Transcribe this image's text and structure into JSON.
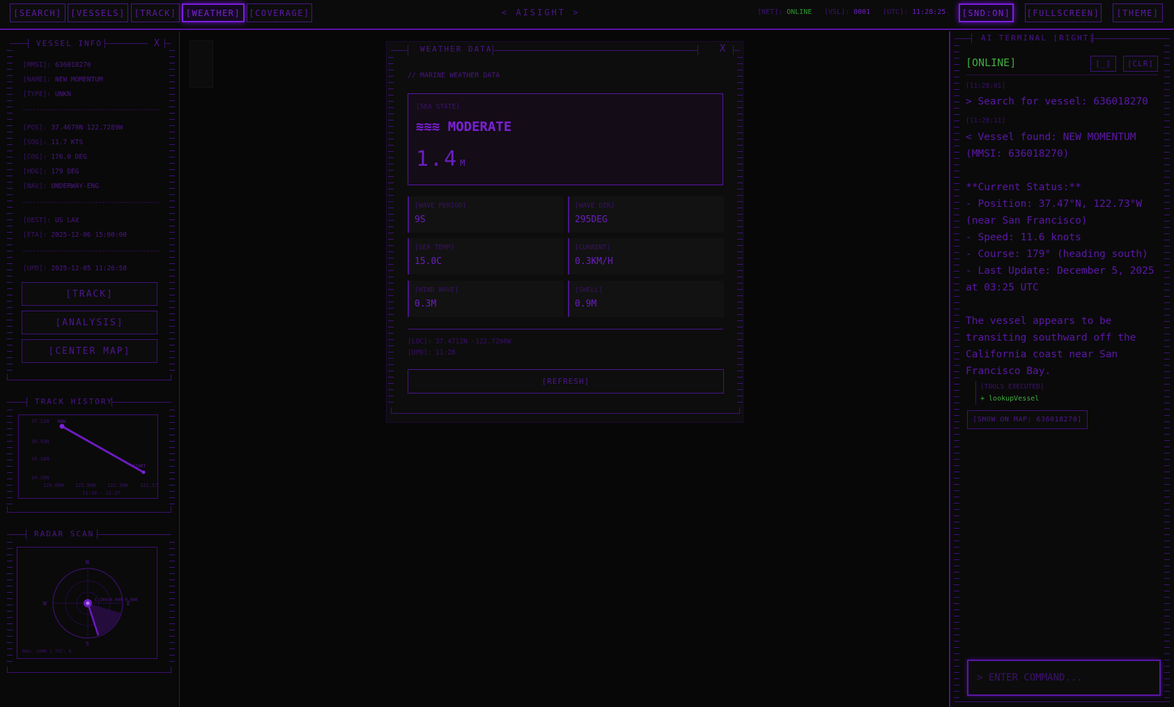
{
  "topbar": {
    "nav": [
      "[SEARCH]",
      "[VESSELS]",
      "[TRACK]",
      "[WEATHER]",
      "[COVERAGE]"
    ],
    "brand": "< AISIGHT >",
    "net_key": "[NET]:",
    "net_val": "ONLINE",
    "vsl_key": "[VSL]:",
    "vsl_val": "0001",
    "utc_key": "[UTC]:",
    "utc_val": "11:28:25",
    "snd": "[SND:ON]",
    "fullscreen": "[FULLSCREEN]",
    "theme": "[THEME]"
  },
  "vessel_info": {
    "title": "VESSEL INFO",
    "close": "X",
    "rows1": [
      {
        "k": "[MMSI]:",
        "v": "636018270"
      },
      {
        "k": "[NAME]:",
        "v": "NEW MOMENTUM"
      },
      {
        "k": "[TYPE]:",
        "v": "UNKN"
      }
    ],
    "rows2": [
      {
        "k": "[POS]:",
        "v": "37.4679N 122.7289W"
      },
      {
        "k": "[SOG]:",
        "v": "11.7 KTS"
      },
      {
        "k": "[COG]:",
        "v": "176.0 DEG"
      },
      {
        "k": "[HDG]:",
        "v": "179 DEG"
      },
      {
        "k": "[NAV]:",
        "v": "UNDERWAY-ENG"
      }
    ],
    "rows3": [
      {
        "k": "[DEST]:",
        "v": "US LAX"
      },
      {
        "k": "[ETA]:",
        "v": "2025-12-06 15:00:00"
      }
    ],
    "rows4": [
      {
        "k": "[UPD]:",
        "v": "2025-12-05 11:26:58"
      }
    ],
    "buttons": [
      "[TRACK]",
      "[ANALYSIS]",
      "[CENTER MAP]"
    ]
  },
  "track_history": {
    "title": "TRACK HISTORY",
    "ylabels": [
      "37.12N",
      "36.43N",
      "35.18N",
      "34.10N"
    ],
    "xlabels": [
      "123.00W",
      "122.86W",
      "122.30W",
      "121.57"
    ],
    "now_label": "NOW",
    "start_label": "START",
    "time_range": "11:18 - 11:27"
  },
  "radar": {
    "title": "RADAR SCAN",
    "n": "N",
    "s": "S",
    "w": "W",
    "e": "E",
    "target_label": "C:100/0.000 0.000",
    "footer": "RNG: 10NM | TGT: 0"
  },
  "weather": {
    "title": "WEATHER DATA",
    "close": "X",
    "subtitle": "// MARINE WEATHER DATA",
    "sea_state_label": "[SEA STATE]",
    "sea_state_icon": "≋≋≋",
    "sea_state": "MODERATE",
    "wave_height": "1.4",
    "wave_unit": "M",
    "cells": [
      {
        "label": "[WAVE PERIOD]",
        "value": "9S"
      },
      {
        "label": "[WAVE DIR]",
        "value": "295DEG"
      },
      {
        "label": "[SEA TEMP]",
        "value": "15.0C"
      },
      {
        "label": "[CURRENT]",
        "value": "0.3KM/H"
      },
      {
        "label": "[WIND WAVE]",
        "value": "0.3M"
      },
      {
        "label": "[SWELL]",
        "value": "0.9M"
      }
    ],
    "loc": "[LOC]: 37.4712N -122.7290W",
    "upd": "[UPD]: 11:28",
    "refresh": "[REFRESH]"
  },
  "terminal": {
    "title": "AI TERMINAL [RIGHT]",
    "status": "[ONLINE]",
    "btn_min": "[_]",
    "btn_clr": "[CLR]",
    "ts1": "[11:28:01]",
    "msg1": "> Search for vessel: 636018270",
    "ts2": "[11:28:11]",
    "msg2": "< Vessel found: NEW MOMENTUM\n(MMSI: 636018270)\n\n**Current Status:**\n- Position: 37.47°N, 122.73°W\n(near San Francisco)\n- Speed: 11.6 knots\n- Course: 179° (heading south)\n- Last Update: December 5, 2025\nat 03:25 UTC\n\nThe vessel appears to be\ntransiting southward off the\nCalifornia coast near San\nFrancisco Bay.",
    "tools_label": "[TOOLS EXECUTED]",
    "tool": "+ lookupVessel",
    "show_map": "[SHOW ON MAP: 636018270]",
    "input_placeholder": "> ENTER COMMAND..."
  },
  "colors": {
    "accent": "#7b1fe0",
    "status_green": "#2f9b2f",
    "background": "#070707"
  }
}
